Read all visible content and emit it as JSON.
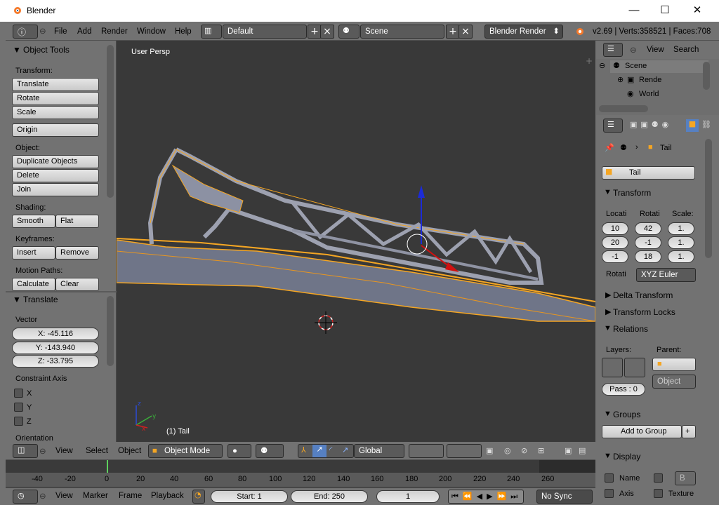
{
  "window": {
    "title": "Blender",
    "minimize": "—",
    "maximize": "☐",
    "close": "✕"
  },
  "topbar": {
    "menu": [
      "File",
      "Add",
      "Render",
      "Window",
      "Help"
    ],
    "layout": "Default",
    "scene": "Scene",
    "engine": "Blender Render",
    "info": "v2.69 | Verts:358521 | Faces:708"
  },
  "toolshelf": {
    "title": "Object Tools",
    "transform_label": "Transform:",
    "translate": "Translate",
    "rotate": "Rotate",
    "scale": "Scale",
    "origin": "Origin",
    "object_label": "Object:",
    "duplicate": "Duplicate Objects",
    "delete": "Delete",
    "join": "Join",
    "shading_label": "Shading:",
    "smooth": "Smooth",
    "flat": "Flat",
    "keyframes_label": "Keyframes:",
    "insert": "Insert",
    "remove": "Remove",
    "motion_label": "Motion Paths:",
    "calculate": "Calculate",
    "clear": "Clear"
  },
  "operator": {
    "title": "Translate",
    "vector_label": "Vector",
    "x": "X: -45.116",
    "y": "Y: -143.940",
    "z": "Z: -33.795",
    "constraint_label": "Constraint Axis",
    "cx": "X",
    "cy": "Y",
    "cz": "Z",
    "orientation": "Orientation"
  },
  "viewport": {
    "label": "User Persp",
    "object": "(1) Tail"
  },
  "view3d_header": {
    "menu": [
      "View",
      "Select",
      "Object"
    ],
    "mode": "Object Mode",
    "orientation": "Global"
  },
  "outliner": {
    "menu": [
      "View",
      "Search"
    ],
    "items": [
      "Scene",
      "Rende",
      "World"
    ]
  },
  "properties": {
    "object_name": "Tail",
    "data_name": "Tail",
    "transform_title": "Transform",
    "loc_label": "Locati",
    "rot_label": "Rotati",
    "scale_label": "Scale:",
    "loc": [
      "10",
      "20",
      "-1"
    ],
    "rot": [
      "42",
      "-1",
      "18"
    ],
    "scale": [
      "1.",
      "1.",
      "1."
    ],
    "rotmode_label": "Rotati",
    "rotmode": "XYZ Euler",
    "delta": "Delta Transform",
    "locks": "Transform Locks",
    "relations": "Relations",
    "layers_label": "Layers:",
    "parent_label": "Parent:",
    "parent_type": "Object",
    "pass": "Pass : 0",
    "groups": "Groups",
    "add_group": "Add to Group",
    "display": "Display",
    "name": "Name",
    "axis": "Axis",
    "texture": "Texture",
    "bounds": "B"
  },
  "timeline": {
    "ticks": [
      "-40",
      "-20",
      "0",
      "20",
      "40",
      "60",
      "80",
      "100",
      "120",
      "140",
      "160",
      "180",
      "200",
      "220",
      "240",
      "260"
    ],
    "menu": [
      "View",
      "Marker",
      "Frame",
      "Playback"
    ],
    "start": "Start: 1",
    "end": "End: 250",
    "current": "1",
    "sync": "No Sync"
  },
  "colors": {
    "accent": "#f5a623",
    "panel": "#727272",
    "viewport": "#393939",
    "mesh": "#8a8fa0"
  }
}
